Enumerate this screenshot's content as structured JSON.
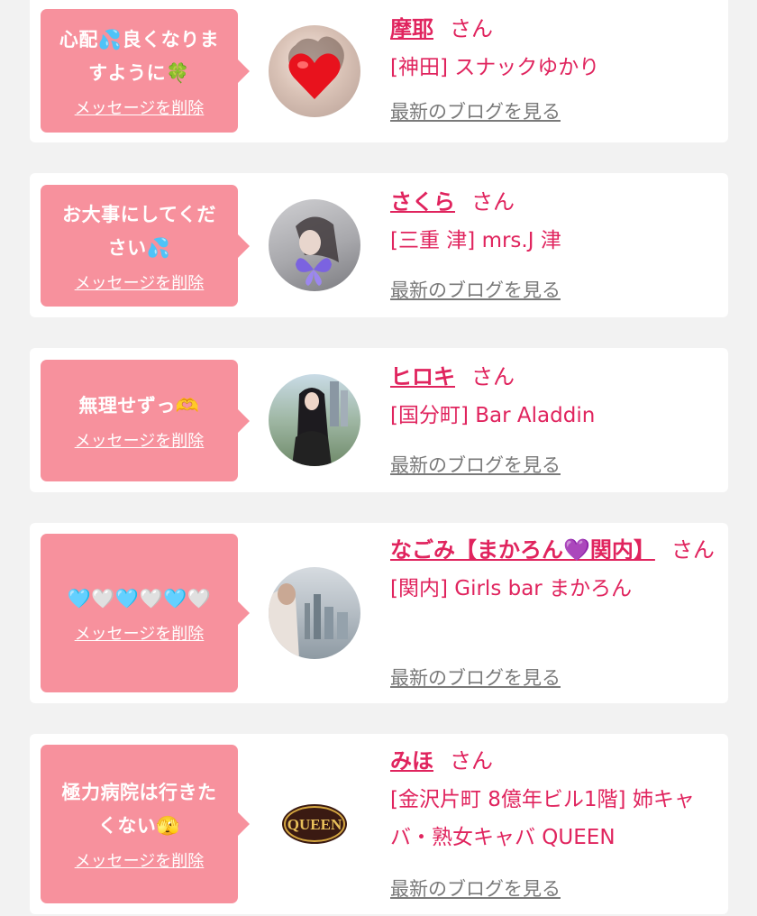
{
  "cards": [
    {
      "message": "心配💦良くなりますように🍀",
      "message_lines": [
        "心配💦良くなりま",
        "すように🍀"
      ],
      "delete_label": "メッセージを削除",
      "name": "摩耶",
      "honorific": "さん",
      "shop": "[神田] スナックゆかり",
      "blog_label": "最新のブログを見る"
    },
    {
      "message": "お大事にしてください💦",
      "message_lines": [
        "お大事にしてくだ",
        "さい💦"
      ],
      "delete_label": "メッセージを削除",
      "name": "さくら",
      "honorific": "さん",
      "shop": "[三重 津] mrs.J 津",
      "blog_label": "最新のブログを見る"
    },
    {
      "message": "無理せずっ🫶",
      "message_lines": [
        "無理せずっ🫶"
      ],
      "delete_label": "メッセージを削除",
      "name": "ヒロキ",
      "honorific": "さん",
      "shop": "[国分町] Bar Aladdin",
      "blog_label": "最新のブログを見る"
    },
    {
      "message": "🩵🤍🩵🤍🩵🤍",
      "message_lines": [
        "🩵🤍🩵🤍🩵🤍"
      ],
      "delete_label": "メッセージを削除",
      "name": "なごみ【まかろん💜関内】",
      "honorific": "さん",
      "shop": "[関内] Girls bar まかろん",
      "blog_label": "最新のブログを見る"
    },
    {
      "message": "極力病院は行きたくない🫣",
      "message_lines": [
        "極力病院は行きた",
        "くない🫣"
      ],
      "delete_label": "メッセージを削除",
      "name": "みほ",
      "honorific": "さん",
      "shop_lines": [
        "[金沢片町 8億年ビル1階] 姉キャ",
        "バ・熟女キャバ QUEEN"
      ],
      "blog_label": "最新のブログを見る",
      "logo_text": "QUEEN"
    }
  ]
}
